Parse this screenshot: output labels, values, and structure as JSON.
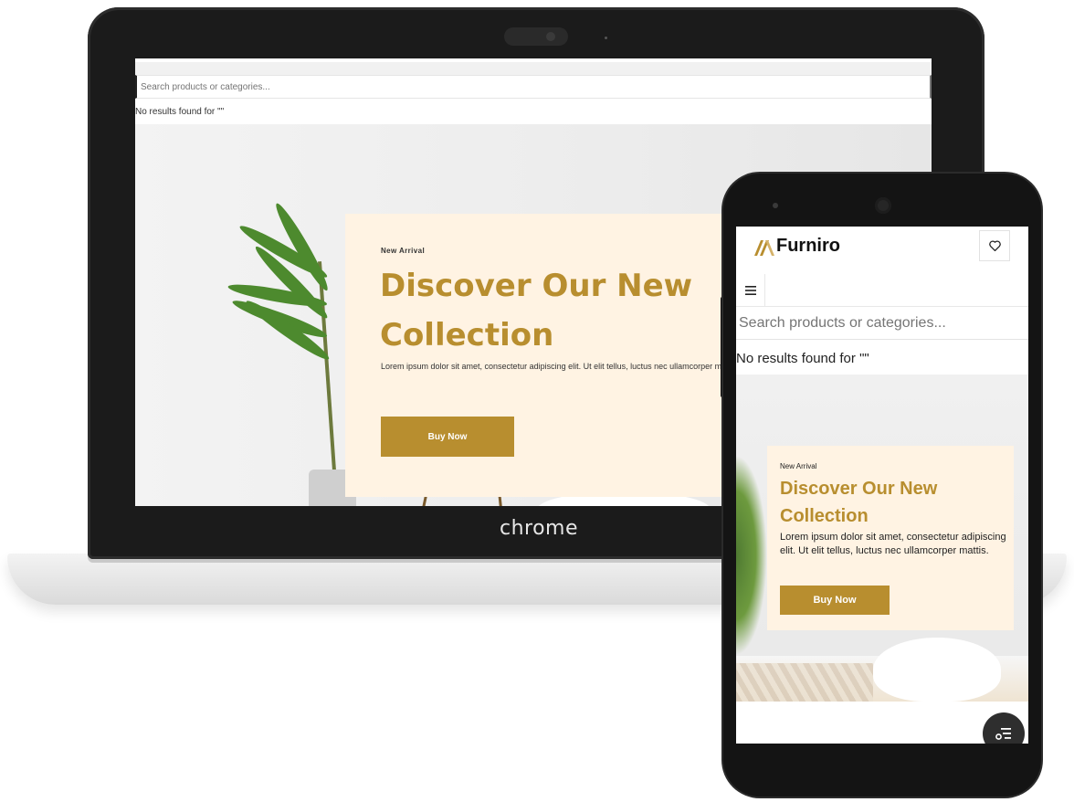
{
  "laptop": {
    "brand_label": "chrome",
    "site": {
      "search_placeholder": "Search products or categories...",
      "results_text": "No results found for \"\"",
      "hero": {
        "badge": "New Arrival",
        "title": "Discover Our New Collection",
        "description": "Lorem ipsum dolor sit amet, consectetur adipiscing elit. Ut elit tellus, luctus nec ullamcorper mattis.",
        "button_label": "Buy Now"
      }
    }
  },
  "phone": {
    "site": {
      "logo_text": "Furniro",
      "favorites_icon": "heart-icon",
      "menu_icon": "hamburger-icon",
      "search_placeholder": "Search products or categories...",
      "results_text": "No results found for \"\"",
      "hero": {
        "badge": "New Arrival",
        "title": "Discover Our New Collection",
        "description": "Lorem ipsum dolor sit amet, consectetur adipiscing elit. Ut elit tellus, luctus nec ullamcorper mattis.",
        "button_label": "Buy Now"
      },
      "fab_icon": "filter-list-icon"
    }
  },
  "colors": {
    "accent": "#B88E2F",
    "card_bg": "#FFF3E3",
    "device_frame": "#141414"
  }
}
